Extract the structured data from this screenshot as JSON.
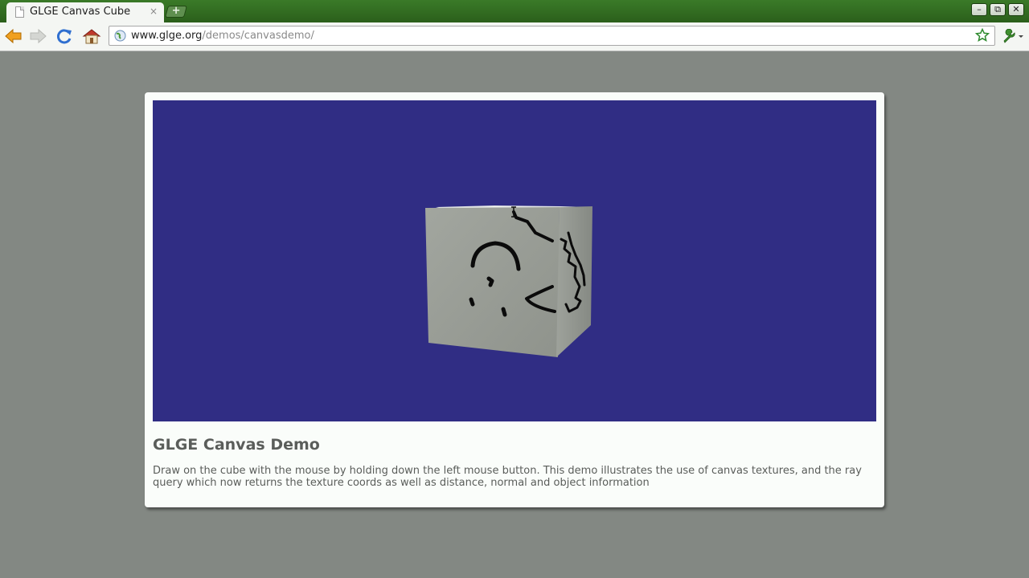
{
  "browser": {
    "tab_title": "GLGE Canvas Cube",
    "tab_close": "×",
    "new_tab_label": "+",
    "window_controls": {
      "minimize": "–",
      "restore": "⧉",
      "close": "✕"
    },
    "url_host": "www.glge.org",
    "url_path": "/demos/canvasdemo/",
    "icons": [
      "back-icon",
      "forward-icon",
      "reload-icon",
      "home-icon",
      "globe-icon",
      "star-icon",
      "wrench-icon"
    ]
  },
  "page": {
    "title": "GLGE Canvas Demo",
    "description": "Draw on the cube with the mouse by holding down the left mouse button. This demo illustrates the use of canvas textures, and the ray query which now returns the texture coords as well as distance, normal and object information"
  },
  "colors": {
    "titlebar": "#2f6a1f",
    "page_background": "#838883",
    "canvas_background": "#302d84",
    "cube_face": "#9a9e98",
    "heading_text": "#5a5d5a"
  }
}
